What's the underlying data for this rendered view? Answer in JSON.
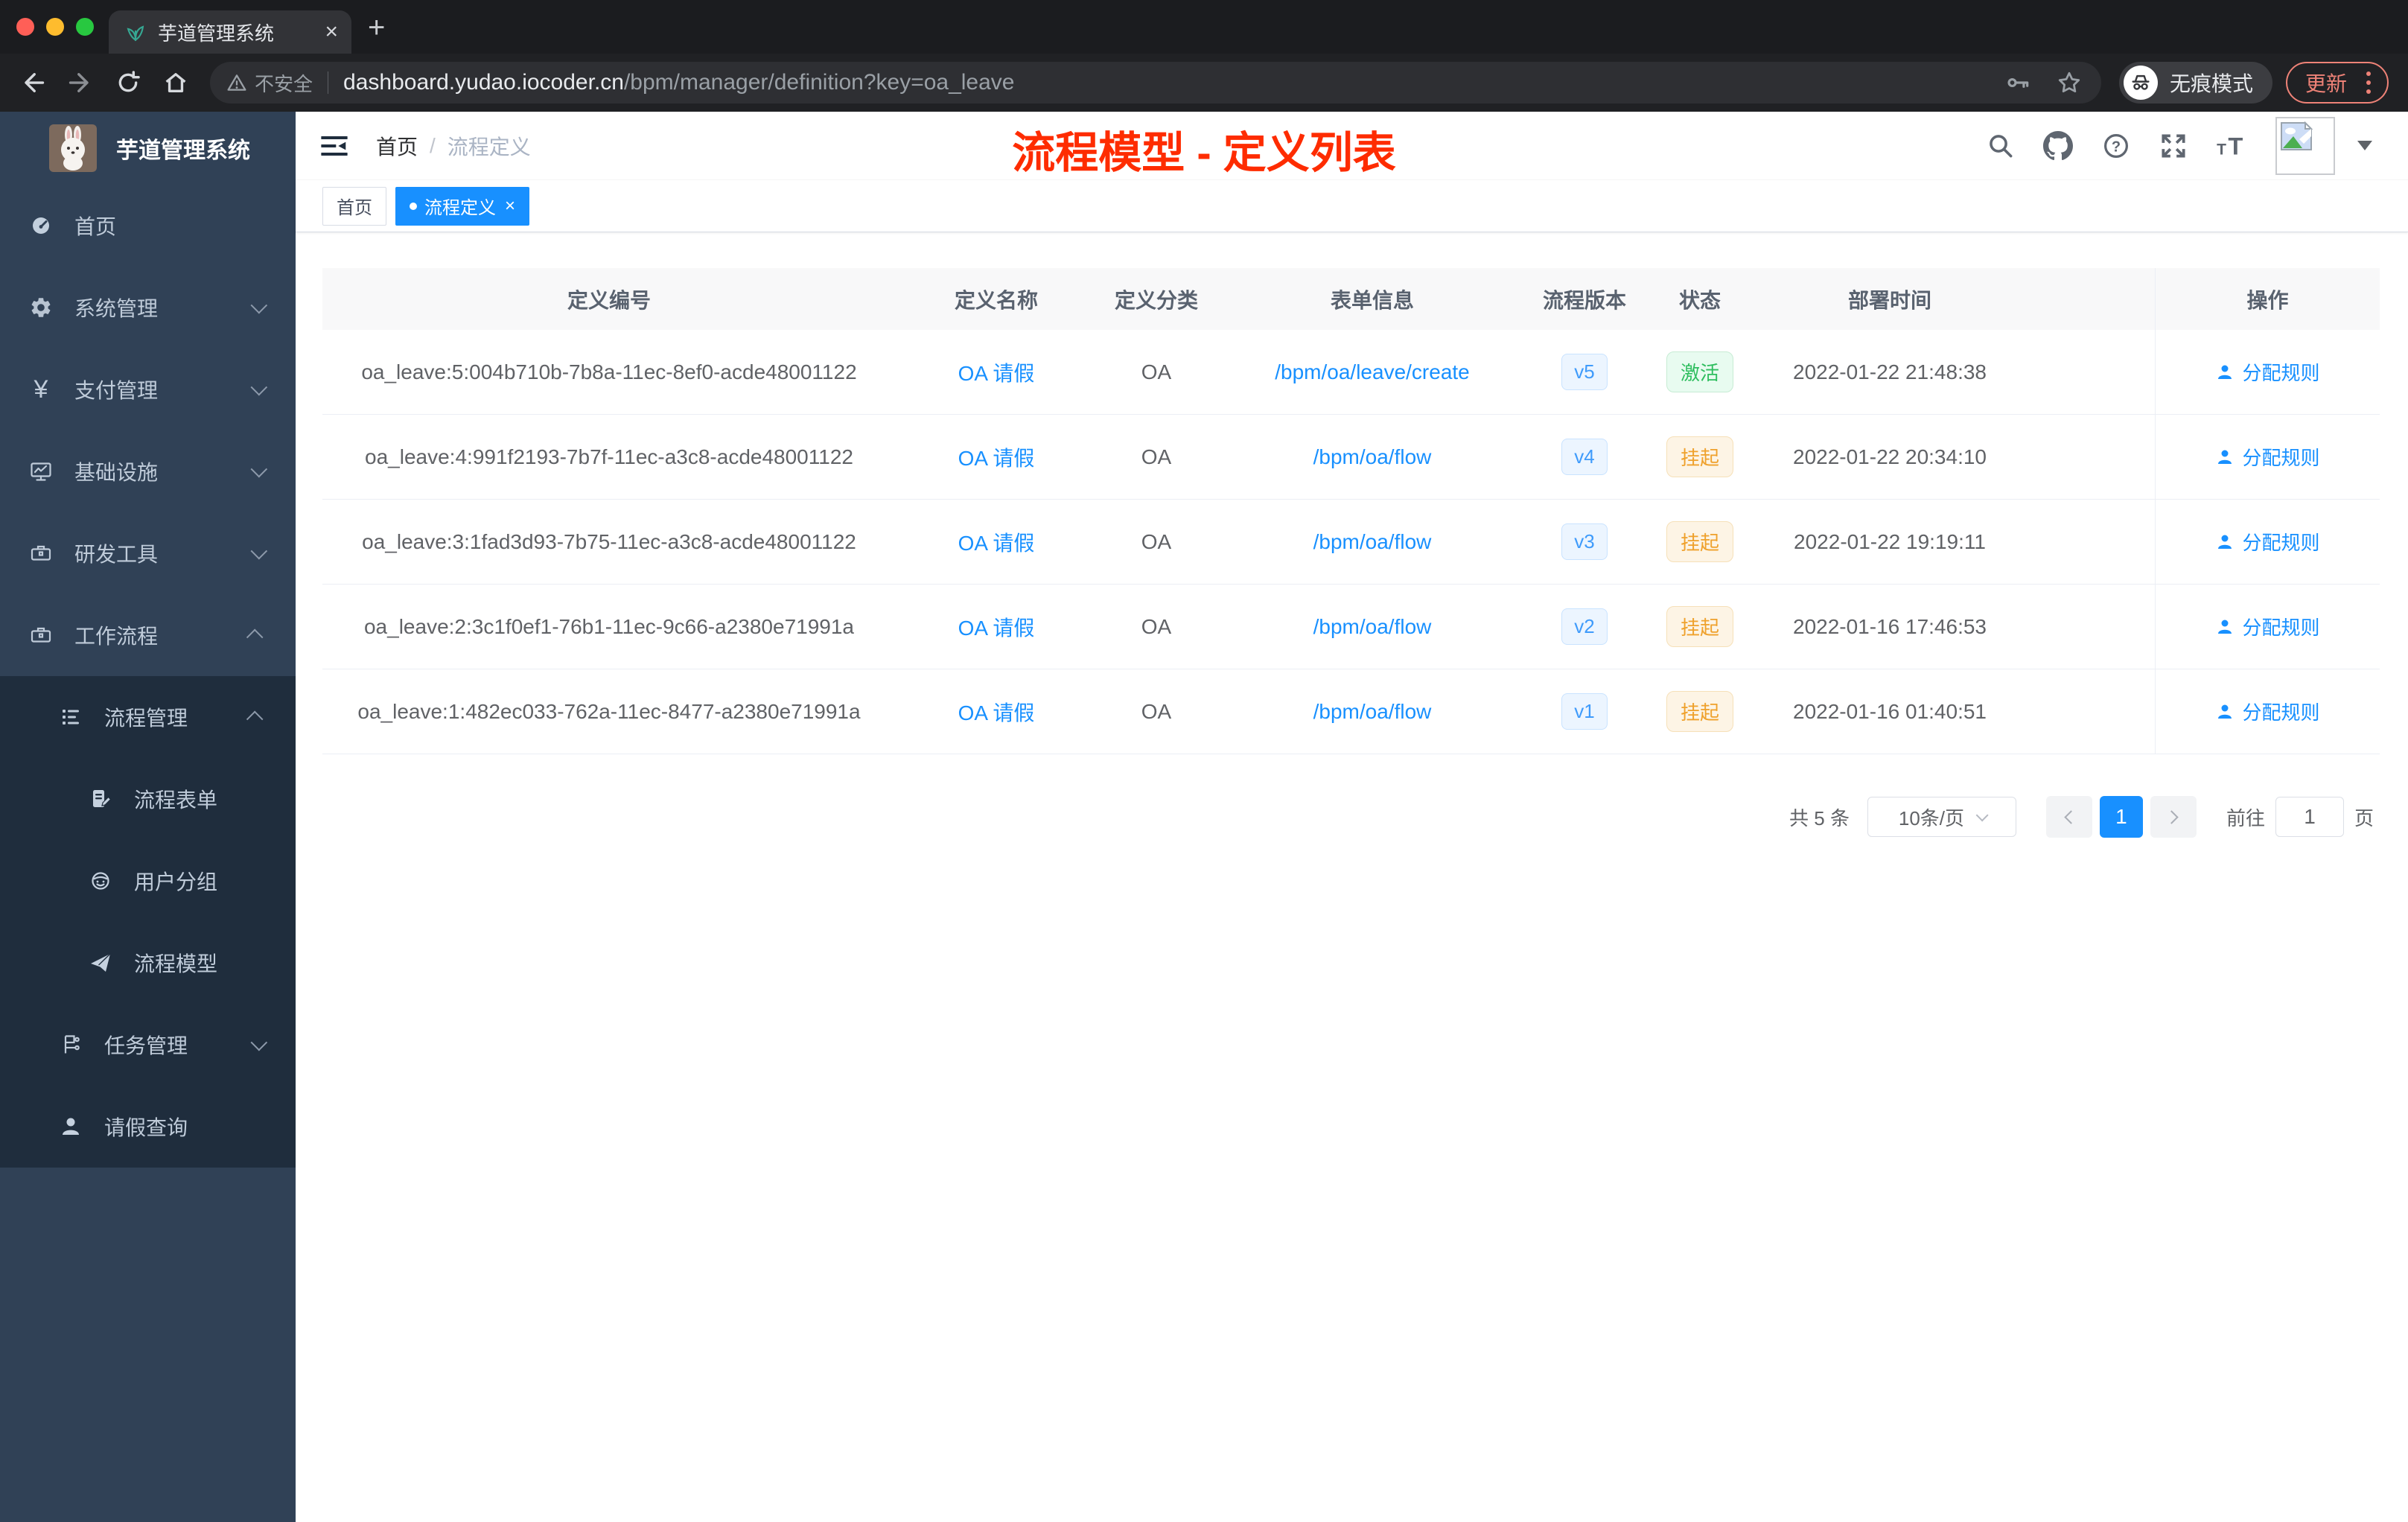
{
  "browser": {
    "tab_title": "芋道管理系统",
    "tab_close_glyph": "×",
    "new_tab_glyph": "+",
    "not_secure_label": "不安全",
    "url_host": "dashboard.yudao.iocoder.cn",
    "url_path": "/bpm/manager/definition?key=oa_leave",
    "incognito_label": "无痕模式",
    "update_button_label": "更新"
  },
  "sidebar": {
    "logo_title": "芋道管理系统",
    "items": [
      {
        "label": "首页",
        "icon": "dashboard-icon",
        "level": 0
      },
      {
        "label": "系统管理",
        "icon": "gear-icon",
        "level": 0,
        "chevron": "down"
      },
      {
        "label": "支付管理",
        "icon": "yen-icon",
        "level": 0,
        "chevron": "down"
      },
      {
        "label": "基础设施",
        "icon": "monitor-icon",
        "level": 0,
        "chevron": "down"
      },
      {
        "label": "研发工具",
        "icon": "briefcase-icon",
        "level": 0,
        "chevron": "down"
      },
      {
        "label": "工作流程",
        "icon": "briefcase-icon",
        "level": 0,
        "chevron": "up"
      },
      {
        "label": "流程管理",
        "icon": "list-icon",
        "level": 1,
        "chevron": "up"
      },
      {
        "label": "流程表单",
        "icon": "form-edit-icon",
        "level": 2
      },
      {
        "label": "用户分组",
        "icon": "user-group-icon",
        "level": 2
      },
      {
        "label": "流程模型",
        "icon": "paper-plane-icon",
        "level": 2
      },
      {
        "label": "任务管理",
        "icon": "tasks-icon",
        "level": 1,
        "chevron": "down"
      },
      {
        "label": "请假查询",
        "icon": "person-icon",
        "level": 1
      }
    ]
  },
  "navbar": {
    "breadcrumb": {
      "home": "首页",
      "separator": "/",
      "current": "流程定义"
    },
    "annotation": "流程模型 - 定义列表",
    "icons": [
      "search-icon",
      "github-icon",
      "help-icon",
      "fullscreen-icon",
      "font-size-icon",
      "avatar-broken-image",
      "caret-down-icon"
    ]
  },
  "tags": [
    {
      "label": "首页",
      "active": false
    },
    {
      "label": "流程定义",
      "active": true,
      "close_glyph": "×"
    }
  ],
  "table": {
    "columns": [
      "定义编号",
      "定义名称",
      "定义分类",
      "表单信息",
      "流程版本",
      "状态",
      "部署时间",
      "操作"
    ],
    "action_label": "分配规则",
    "rows": [
      {
        "id": "oa_leave:5:004b710b-7b8a-11ec-8ef0-acde48001122",
        "name": "OA 请假",
        "category": "OA",
        "form": "/bpm/oa/leave/create",
        "version": "v5",
        "status": "激活",
        "status_type": "active",
        "time": "2022-01-22 21:48:38"
      },
      {
        "id": "oa_leave:4:991f2193-7b7f-11ec-a3c8-acde48001122",
        "name": "OA 请假",
        "category": "OA",
        "form": "/bpm/oa/flow",
        "version": "v4",
        "status": "挂起",
        "status_type": "suspended",
        "time": "2022-01-22 20:34:10"
      },
      {
        "id": "oa_leave:3:1fad3d93-7b75-11ec-a3c8-acde48001122",
        "name": "OA 请假",
        "category": "OA",
        "form": "/bpm/oa/flow",
        "version": "v3",
        "status": "挂起",
        "status_type": "suspended",
        "time": "2022-01-22 19:19:11"
      },
      {
        "id": "oa_leave:2:3c1f0ef1-76b1-11ec-9c66-a2380e71991a",
        "name": "OA 请假",
        "category": "OA",
        "form": "/bpm/oa/flow",
        "version": "v2",
        "status": "挂起",
        "status_type": "suspended",
        "time": "2022-01-16 17:46:53"
      },
      {
        "id": "oa_leave:1:482ec033-762a-11ec-8477-a2380e71991a",
        "name": "OA 请假",
        "category": "OA",
        "form": "/bpm/oa/flow",
        "version": "v1",
        "status": "挂起",
        "status_type": "suspended",
        "time": "2022-01-16 01:40:51"
      }
    ]
  },
  "pagination": {
    "total_label": "共 5 条",
    "page_size_label": "10条/页",
    "current_page": "1",
    "goto_label": "前往",
    "goto_value": "1",
    "page_unit": "页"
  },
  "colors": {
    "accent_blue": "#1890ff",
    "annotation_red": "#fe2c00",
    "status_active_green": "#2fbe5f",
    "status_suspended_orange": "#efa12c",
    "sidebar_bg": "#304156",
    "sidebar_submenu_bg": "#1f2d3d",
    "update_button_coral": "#ee8277"
  }
}
